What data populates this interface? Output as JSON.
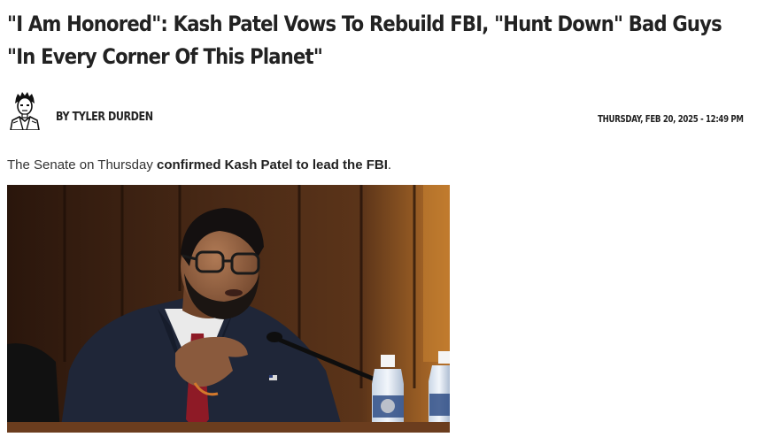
{
  "article": {
    "headline": "\"I Am Honored\": Kash Patel Vows To Rebuild FBI, \"Hunt Down\" Bad Guys \"In Every Corner Of This Planet\"",
    "byline": {
      "prefix": "BY",
      "author": "TYLER DURDEN",
      "date": "THURSDAY, FEB 20, 2025 - 12:49 PM"
    },
    "lede": {
      "before": "The Senate on Thursday ",
      "bold": "confirmed Kash Patel to lead the FBI",
      "after": "."
    }
  },
  "icons": {
    "author_avatar": "author-avatar-icon"
  }
}
